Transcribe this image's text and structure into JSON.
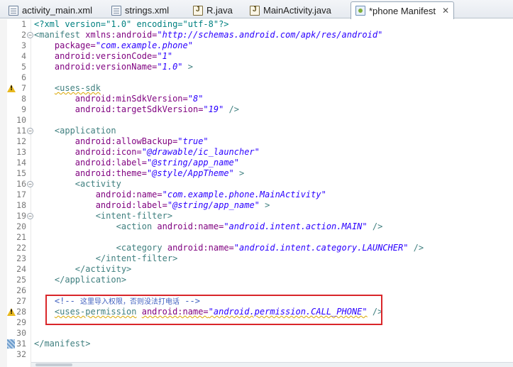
{
  "tabs": [
    {
      "label": "activity_main.xml",
      "icon": "xml-file-icon"
    },
    {
      "label": "strings.xml",
      "icon": "xml-file-icon"
    },
    {
      "label": "R.java",
      "icon": "java-file-icon"
    },
    {
      "label": "MainActivity.java",
      "icon": "java-file-icon"
    },
    {
      "label": "*phone Manifest",
      "icon": "manifest-file-icon",
      "active": true,
      "close_glyph": "✕"
    }
  ],
  "lines": {
    "1": {
      "number": "1",
      "pi": "<?xml version=\"1.0\" encoding=\"utf-8\"?>"
    },
    "2": {
      "number": "2",
      "tag": "<manifest",
      "attr": "xmlns:android=",
      "val": "\"http://schemas.android.com/apk/res/android\""
    },
    "3": {
      "number": "3",
      "attr": "package=",
      "val": "\"com.example.phone\""
    },
    "4": {
      "number": "4",
      "attr": "android:versionCode=",
      "val": "\"1\""
    },
    "5": {
      "number": "5",
      "attr": "android:versionName=",
      "val": "\"1.0\"",
      "close": " >"
    },
    "6": {
      "number": "6"
    },
    "7": {
      "number": "7",
      "tag": "<uses-sdk"
    },
    "8": {
      "number": "8",
      "attr": "android:minSdkVersion=",
      "val": "\"8\""
    },
    "9": {
      "number": "9",
      "attr": "android:targetSdkVersion=",
      "val": "\"19\"",
      "close": " />"
    },
    "10": {
      "number": "10"
    },
    "11": {
      "number": "11",
      "tag": "<application"
    },
    "12": {
      "number": "12",
      "attr": "android:allowBackup=",
      "val": "\"true\""
    },
    "13": {
      "number": "13",
      "attr": "android:icon=",
      "val": "\"@drawable/ic_launcher\""
    },
    "14": {
      "number": "14",
      "attr": "android:label=",
      "val": "\"@string/app_name\""
    },
    "15": {
      "number": "15",
      "attr": "android:theme=",
      "val": "\"@style/AppTheme\"",
      "close": " >"
    },
    "16": {
      "number": "16",
      "tag": "<activity"
    },
    "17": {
      "number": "17",
      "attr": "android:name=",
      "val": "\"com.example.phone.MainActivity\""
    },
    "18": {
      "number": "18",
      "attr": "android:label=",
      "val": "\"@string/app_name\"",
      "close": " >"
    },
    "19": {
      "number": "19",
      "tag": "<intent-filter>"
    },
    "20": {
      "number": "20",
      "tag": "<action",
      "attr": "android:name=",
      "val": "\"android.intent.action.MAIN\"",
      "close": " />"
    },
    "21": {
      "number": "21"
    },
    "22": {
      "number": "22",
      "tag": "<category",
      "attr": "android:name=",
      "val": "\"android.intent.category.LAUNCHER\"",
      "close": " />"
    },
    "23": {
      "number": "23",
      "tag": "</intent-filter>"
    },
    "24": {
      "number": "24",
      "tag": "</activity>"
    },
    "25": {
      "number": "25",
      "tag": "</application>"
    },
    "26": {
      "number": "26"
    },
    "27": {
      "number": "27",
      "comment_open": "<!--",
      "comment_text": "这里导入权限，否则没法打电话",
      "comment_close": "-->"
    },
    "28": {
      "number": "28",
      "tag": "<uses-permission",
      "attr": "android:name=",
      "val": "\"android.permission.CALL_PHONE\"",
      "close": " />"
    },
    "29": {
      "number": "29"
    },
    "30": {
      "number": "30"
    },
    "31": {
      "number": "31",
      "tag": "</manifest>"
    },
    "32": {
      "number": "32"
    }
  },
  "markers": {
    "warning_lines": [
      "7",
      "28"
    ],
    "bookmark_lines": [
      "31"
    ],
    "fold_lines": [
      "2",
      "11",
      "16",
      "19"
    ],
    "fold_glyph": "−"
  },
  "colors": {
    "tag": "#3f7f7f",
    "attribute": "#7f007f",
    "value": "#2a00ff",
    "comment": "#3f5fbf",
    "highlight_box": "#d9262a",
    "warning": "#e8b81d"
  }
}
